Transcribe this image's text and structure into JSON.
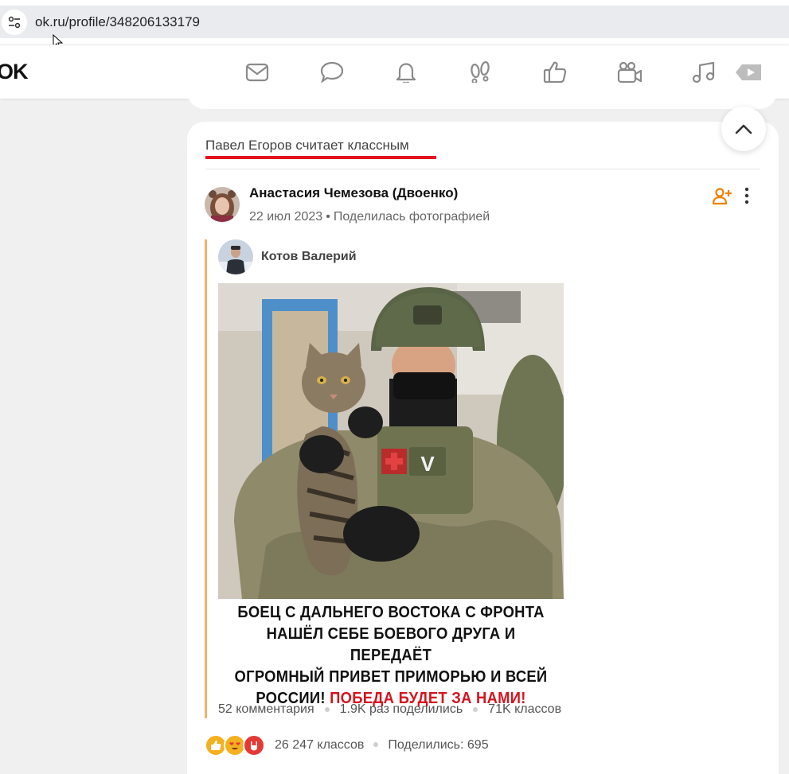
{
  "browser": {
    "url": "ok.ru/profile/348206133179"
  },
  "nav": {
    "logo": "OK",
    "icons": [
      "messages-icon",
      "discussions-icon",
      "notifications-icon",
      "guests-icon",
      "events-icon",
      "video-icon",
      "music-icon",
      "more-video-icon"
    ]
  },
  "feed": {
    "header": "Павел Егоров считает классным",
    "post": {
      "author": "Анастасия Чемезова (Двоенко)",
      "date": "22 июл 2023",
      "dot": "•",
      "action": "Поделилась фотографией",
      "repost": {
        "author": "Котов Валерий",
        "caption_line1": "БОЕЦ С ДАЛЬНЕГО ВОСТОКА С ФРОНТА",
        "caption_line2": "НАШЁЛ СЕБЕ БОЕВОГО ДРУГА И ПЕРЕДАЁТ",
        "caption_line3": "ОГРОМНЫЙ ПРИВЕТ ПРИМОРЬЮ И ВСЕЙ",
        "caption_line4_black": "РОССИИ!",
        "caption_line4_red": "ПОБЕДА БУДЕТ ЗА НАМИ!",
        "patch_letter": "V",
        "comments": "52 комментария",
        "shares": "1.9K раз поделились",
        "likes": "71K классов"
      },
      "reactions_count": "26 247 классов",
      "shared_count": "Поделились: 695"
    }
  },
  "colors": {
    "accent_red": "#e3141f",
    "ok_orange": "#ee8208",
    "repost_bar": "#f3b26b"
  }
}
